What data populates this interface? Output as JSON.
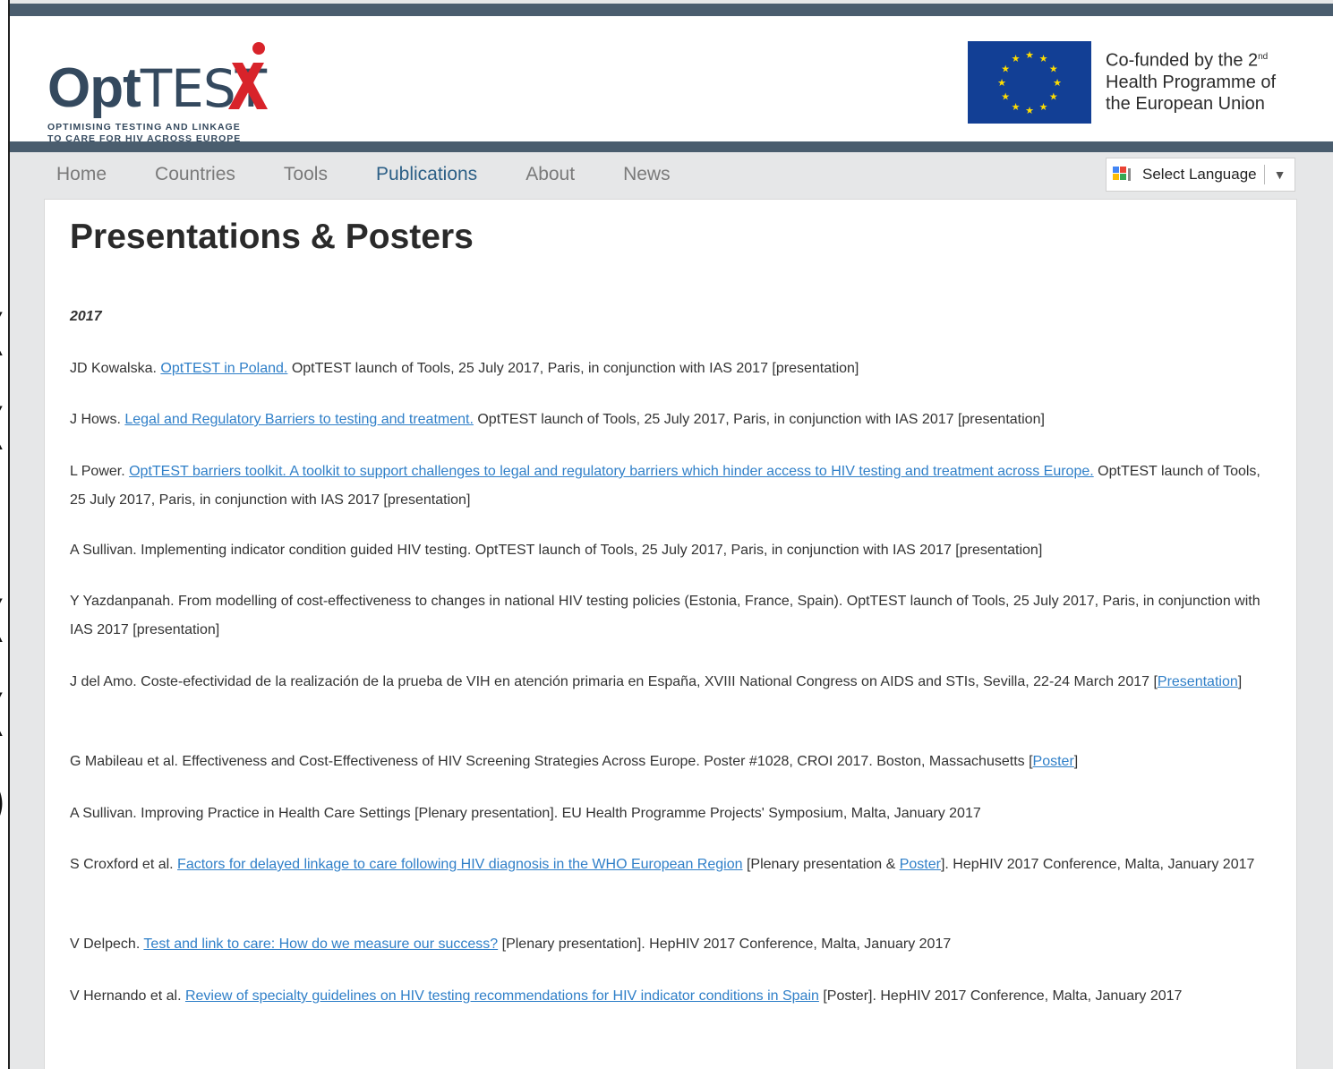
{
  "header": {
    "logo": {
      "opt": "Opt",
      "test": "TEST",
      "tagline_1": "OPTIMISING TESTING AND LINKAGE",
      "tagline_2": "TO CARE FOR HIV ACROSS EUROPE"
    },
    "eu_funding": {
      "line1_a": "Co-funded by the 2",
      "line1_sup": "nd",
      "line2": "Health Programme of",
      "line3": "the European Union"
    },
    "brand_color": "#34495e",
    "accent_red": "#d8232a",
    "eu_blue": "#123f95"
  },
  "nav": {
    "items": [
      {
        "label": "Home",
        "active": false
      },
      {
        "label": "Countries",
        "active": false
      },
      {
        "label": "Tools",
        "active": false
      },
      {
        "label": "Publications",
        "active": true
      },
      {
        "label": "About",
        "active": false
      },
      {
        "label": "News",
        "active": false
      }
    ]
  },
  "language": {
    "label": "Select Language",
    "icon": "google-translate-icon"
  },
  "main": {
    "title": "Presentations & Posters",
    "year": "2017",
    "entries": [
      {
        "pre": "JD Kowalska. ",
        "link": "OptTEST in Poland.",
        "post": " OptTEST launch of Tools, 25 July 2017, Paris, in conjunction with IAS 2017 [presentation]"
      },
      {
        "pre": "J Hows. ",
        "link": "Legal and Regulatory Barriers to testing and treatment.",
        "post": " OptTEST launch of Tools, 25 July 2017, Paris, in conjunction with IAS 2017 [presentation]"
      },
      {
        "pre": "L Power. ",
        "link": "OptTEST barriers toolkit. A toolkit to support challenges to legal and regulatory barriers which hinder access to HIV testing and treatment across Europe.",
        "post": " OptTEST launch of Tools, 25 July 2017, Paris, in conjunction with IAS 2017 [presentation]"
      },
      {
        "pre": "A Sullivan. Implementing indicator condition guided HIV testing. OptTEST launch of Tools, 25 July 2017, Paris, in conjunction with IAS 2017 [presentation]",
        "link": "",
        "post": ""
      },
      {
        "pre": "Y Yazdanpanah. From modelling of cost-effectiveness to changes in national HIV testing policies (Estonia, France, Spain). OptTEST launch of Tools, 25 July 2017, Paris, in conjunction with IAS 2017 [presentation]",
        "link": "",
        "post": ""
      },
      {
        "pre": "J del Amo. Coste-efectividad de la realización de la prueba de VIH en atención primaria en España, XVIII National Congress on AIDS and STIs, Sevilla, 22-24 March 2017 [",
        "link": "Presentation",
        "post": "]"
      },
      {
        "pre": "G Mabileau et al. Effectiveness and Cost-Effectiveness of HIV Screening Strategies Across Europe. Poster #1028, CROI 2017. Boston, Massachusetts [",
        "link": "Poster",
        "post": "]"
      },
      {
        "pre": "A Sullivan. Improving Practice in Health Care Settings [Plenary presentation]. EU Health Programme Projects' Symposium, Malta, January 2017",
        "link": "",
        "post": ""
      },
      {
        "pre": "S Croxford et al. ",
        "link": "Factors for delayed linkage to care following HIV diagnosis in the WHO European Region",
        "post": " [Plenary presentation & ",
        "link2": "Poster",
        "post2": "]. HepHIV 2017 Conference, Malta, January 2017"
      },
      {
        "pre": "V Delpech. ",
        "link": "Test and link to care: How do we measure our success?",
        "post": " [Plenary presentation]. HepHIV 2017 Conference, Malta, January 2017"
      },
      {
        "pre": "V Hernando et al. ",
        "link": "Review of specialty guidelines on HIV testing recommendations for HIV indicator conditions in Spain",
        "post": " [Poster]. HepHIV 2017 Conference, Malta, January 2017"
      }
    ]
  }
}
